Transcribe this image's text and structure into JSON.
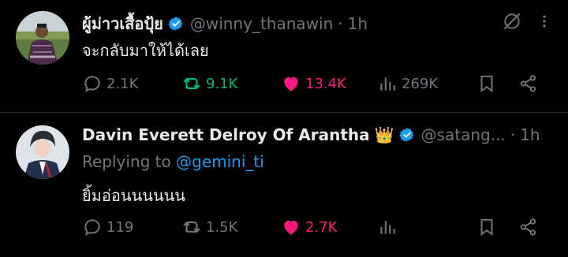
{
  "tweets": [
    {
      "name": "ผู้ม่าวเสื้อปุ้ย",
      "handle": "@winny_thanawin",
      "sep": "·",
      "time": "1h",
      "text": "จะกลับมาให้ได้เลย",
      "replies": "2.1K",
      "retweets": "9.1K",
      "likes": "13.4K",
      "views": "269K"
    },
    {
      "name": "Davin Everett Delroy Of Arantha",
      "crown": "👑",
      "handle": "@satang...",
      "sep": "·",
      "time": "1h",
      "reply_prefix": "Replying to",
      "reply_mention": "@gemini_ti",
      "text": "ยิ้มอ่อนนนนนน",
      "replies": "119",
      "retweets": "1.5K",
      "likes": "2.7K"
    }
  ],
  "colors": {
    "verified": "#1d9bf0",
    "retweet": "#00ba7c",
    "like": "#f91880",
    "muted": "#71767b"
  }
}
